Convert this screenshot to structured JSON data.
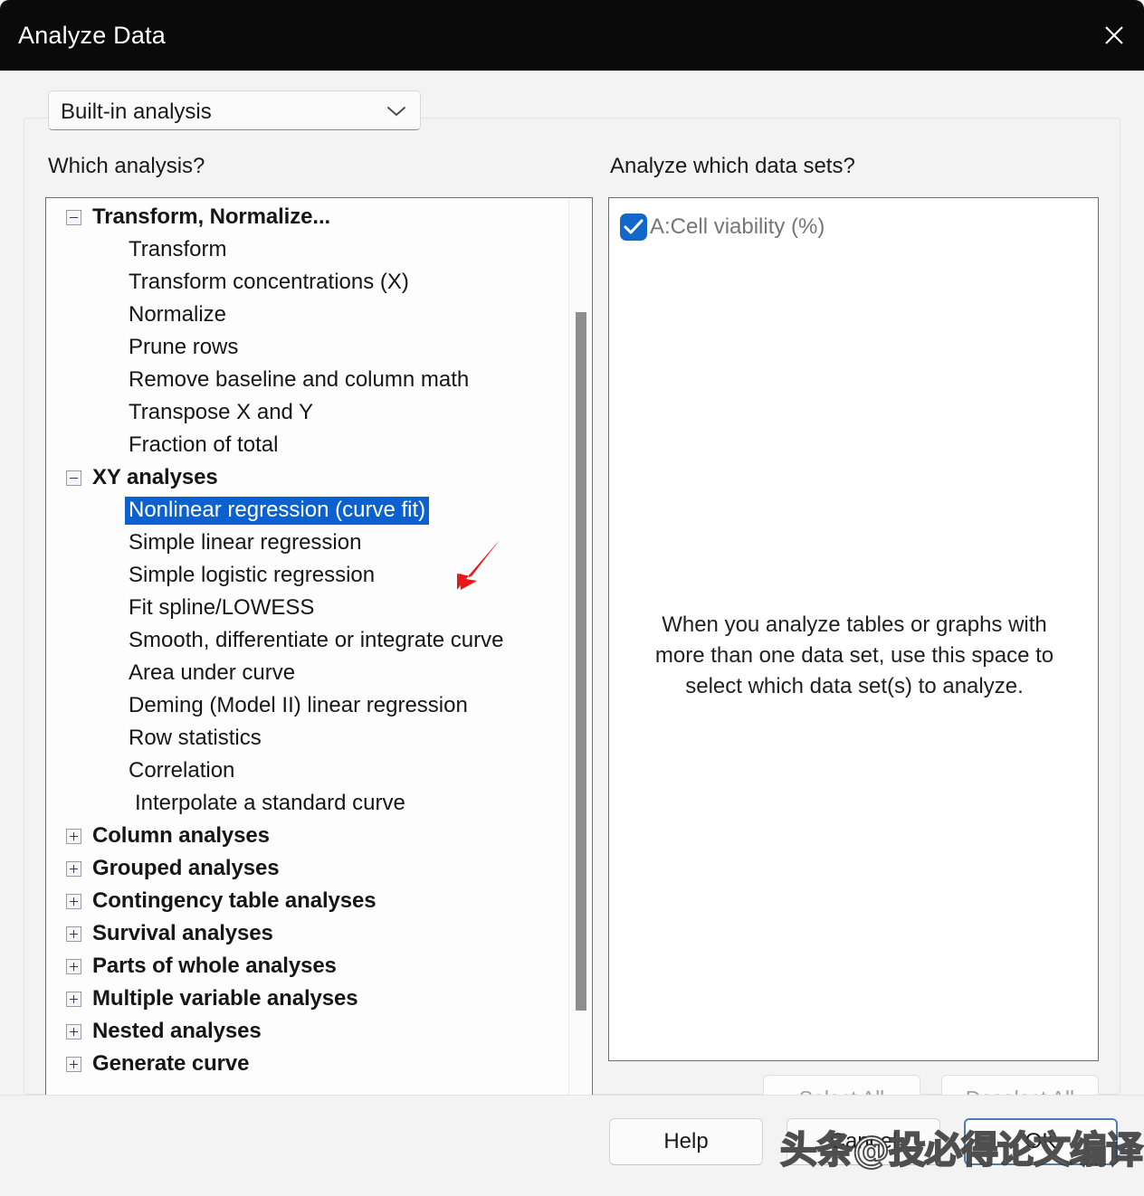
{
  "window": {
    "title": "Analyze Data",
    "close_icon": "close-icon"
  },
  "method_select": {
    "value": "Built-in analysis",
    "chevron_icon": "chevron-down-icon"
  },
  "left_panel": {
    "heading": "Which analysis?",
    "tree": [
      {
        "label": "Transform, Normalize...",
        "type": "group",
        "state": "expanded",
        "expander_icon": "minus-box-icon"
      },
      {
        "label": "Transform",
        "type": "child"
      },
      {
        "label": "Transform concentrations (X)",
        "type": "child"
      },
      {
        "label": "Normalize",
        "type": "child"
      },
      {
        "label": "Prune rows",
        "type": "child"
      },
      {
        "label": "Remove baseline and column math",
        "type": "child"
      },
      {
        "label": "Transpose X and Y",
        "type": "child"
      },
      {
        "label": "Fraction of total",
        "type": "child"
      },
      {
        "label": "XY analyses",
        "type": "group",
        "state": "expanded",
        "expander_icon": "minus-box-icon"
      },
      {
        "label": "Nonlinear regression (curve fit)",
        "type": "child",
        "selected": true
      },
      {
        "label": "Simple linear regression",
        "type": "child"
      },
      {
        "label": "Simple logistic regression",
        "type": "child"
      },
      {
        "label": "Fit spline/LOWESS",
        "type": "child"
      },
      {
        "label": "Smooth, differentiate or integrate curve",
        "type": "child"
      },
      {
        "label": "Area under curve",
        "type": "child"
      },
      {
        "label": "Deming (Model II) linear regression",
        "type": "child"
      },
      {
        "label": "Row statistics",
        "type": "child"
      },
      {
        "label": "Correlation",
        "type": "child"
      },
      {
        "label": "Interpolate a standard curve",
        "type": "child2"
      },
      {
        "label": "Column analyses",
        "type": "group",
        "state": "collapsed",
        "expander_icon": "plus-box-icon"
      },
      {
        "label": "Grouped analyses",
        "type": "group",
        "state": "collapsed",
        "expander_icon": "plus-box-icon"
      },
      {
        "label": "Contingency table analyses",
        "type": "group",
        "state": "collapsed",
        "expander_icon": "plus-box-icon"
      },
      {
        "label": "Survival analyses",
        "type": "group",
        "state": "collapsed",
        "expander_icon": "plus-box-icon"
      },
      {
        "label": "Parts of whole analyses",
        "type": "group",
        "state": "collapsed",
        "expander_icon": "plus-box-icon"
      },
      {
        "label": "Multiple variable analyses",
        "type": "group",
        "state": "collapsed",
        "expander_icon": "plus-box-icon"
      },
      {
        "label": "Nested analyses",
        "type": "group",
        "state": "collapsed",
        "expander_icon": "plus-box-icon"
      },
      {
        "label": "Generate curve",
        "type": "group",
        "state": "collapsed",
        "expander_icon": "plus-box-icon",
        "clipped": true
      }
    ],
    "selected_label": "Nonlinear regression (curve fit)",
    "selection_color": "#0c61d1",
    "scrollbar": {
      "icon": "vertical-scrollbar"
    }
  },
  "right_panel": {
    "heading": "Analyze which data sets?",
    "datasets": [
      {
        "label": "A:Cell viability (%)",
        "checked": true,
        "check_icon": "checkmark-icon",
        "check_color": "#1168c8"
      }
    ],
    "help_text": "When you analyze tables or graphs with more than one data set, use this space to select which data set(s) to analyze.",
    "select_all_label": "Select All",
    "deselect_all_label": "Deselect All"
  },
  "footer": {
    "help_label": "Help",
    "cancel_label": "Cancel",
    "ok_label": "OK",
    "default_button": "OK",
    "default_border_color": "#4d7fb3"
  },
  "annotation": {
    "arrow_icon": "red-arrow-icon",
    "arrow_color": "#e8191b",
    "points_at": "Nonlinear regression (curve fit)"
  },
  "watermark": {
    "text": "头条@投必得论文编译"
  }
}
